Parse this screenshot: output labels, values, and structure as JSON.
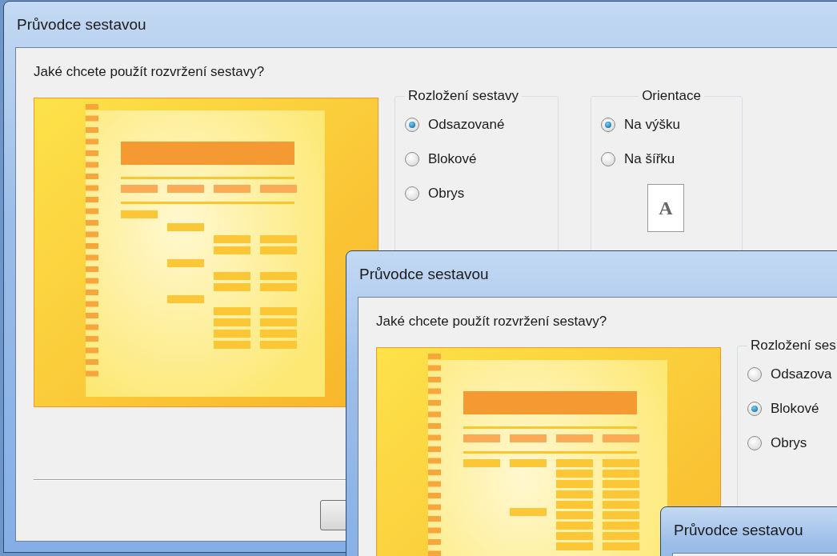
{
  "windows": [
    {
      "title": "Průvodce sestavou",
      "question": "Jaké chcete použít rozvržení sestavy?",
      "preview": {
        "kind": "indented"
      },
      "layout_group": {
        "label": "Rozložení sestavy",
        "options": [
          {
            "label": "Odsazované",
            "selected": true
          },
          {
            "label": "Blokové",
            "selected": false
          },
          {
            "label": "Obrys",
            "selected": false
          }
        ]
      },
      "orientation_group": {
        "label": "Orientace",
        "options": [
          {
            "label": "Na výšku",
            "selected": true
          },
          {
            "label": "Na šířku",
            "selected": false
          }
        ],
        "page_letter": "A"
      },
      "footer": {
        "kind": "separator_button"
      }
    },
    {
      "title": "Průvodce sestavou",
      "question": "Jaké chcete použít rozvržení sestavy?",
      "preview": {
        "kind": "block"
      },
      "layout_group": {
        "label": "Rozložení ses",
        "options": [
          {
            "label": "Odsazova",
            "selected": false
          },
          {
            "label": "Blokové",
            "selected": true
          },
          {
            "label": "Obrys",
            "selected": false
          }
        ]
      }
    },
    {
      "title": "Průvodce sestavou"
    }
  ]
}
